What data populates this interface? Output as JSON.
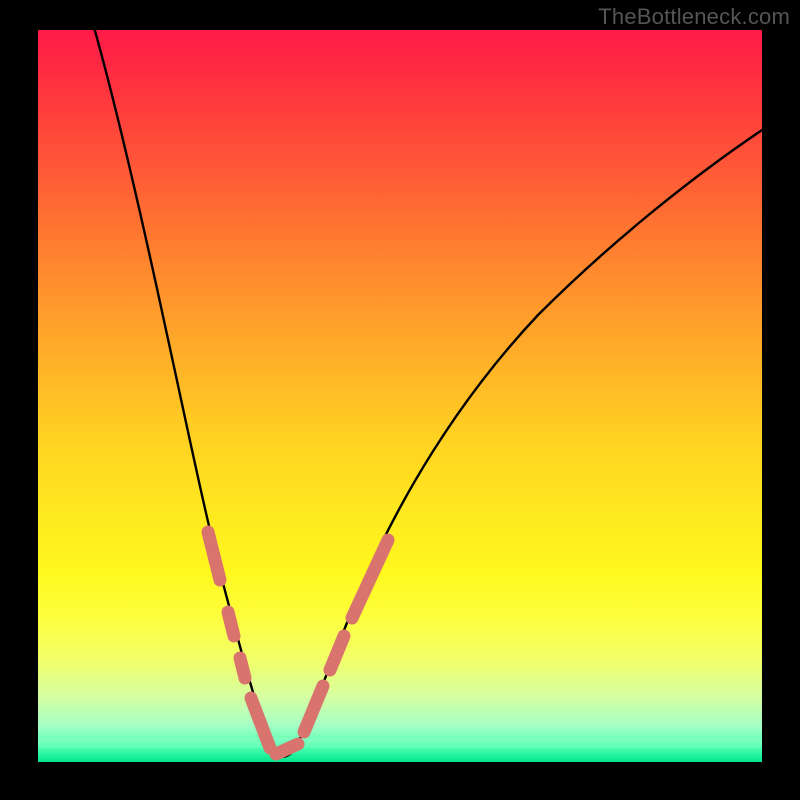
{
  "watermark": "TheBottleneck.com",
  "colors": {
    "background": "#000000",
    "curve": "#000000",
    "marker": "#d9736e",
    "gradient_top": "#ff1a47",
    "gradient_bottom": "#00e68c"
  },
  "chart_data": {
    "type": "line",
    "title": "",
    "xlabel": "",
    "ylabel": "",
    "xlim": [
      0,
      100
    ],
    "ylim": [
      0,
      100
    ],
    "x": [
      0,
      3,
      6,
      9,
      12,
      15,
      18,
      20,
      22,
      24,
      26,
      28,
      29,
      30,
      31,
      32,
      33,
      34,
      36,
      38,
      40,
      43,
      46,
      50,
      55,
      60,
      65,
      70,
      75,
      80,
      85,
      90,
      95,
      100
    ],
    "y": [
      108,
      101,
      94,
      87,
      79,
      71,
      62,
      55,
      47,
      38,
      28,
      18,
      13,
      8,
      4,
      2,
      2,
      4,
      9,
      15,
      21,
      29,
      36,
      44,
      52,
      59,
      65,
      70,
      74,
      78,
      81,
      84,
      86,
      88
    ],
    "minimum_x": 32.5,
    "highlighted_ranges_x": [
      [
        21.5,
        23.5
      ],
      [
        24.5,
        25.5
      ],
      [
        26.0,
        27.0
      ],
      [
        27.5,
        30.5
      ],
      [
        31.0,
        34.0
      ],
      [
        34.5,
        37.0
      ],
      [
        37.5,
        39.5
      ],
      [
        40.0,
        44.5
      ]
    ]
  }
}
